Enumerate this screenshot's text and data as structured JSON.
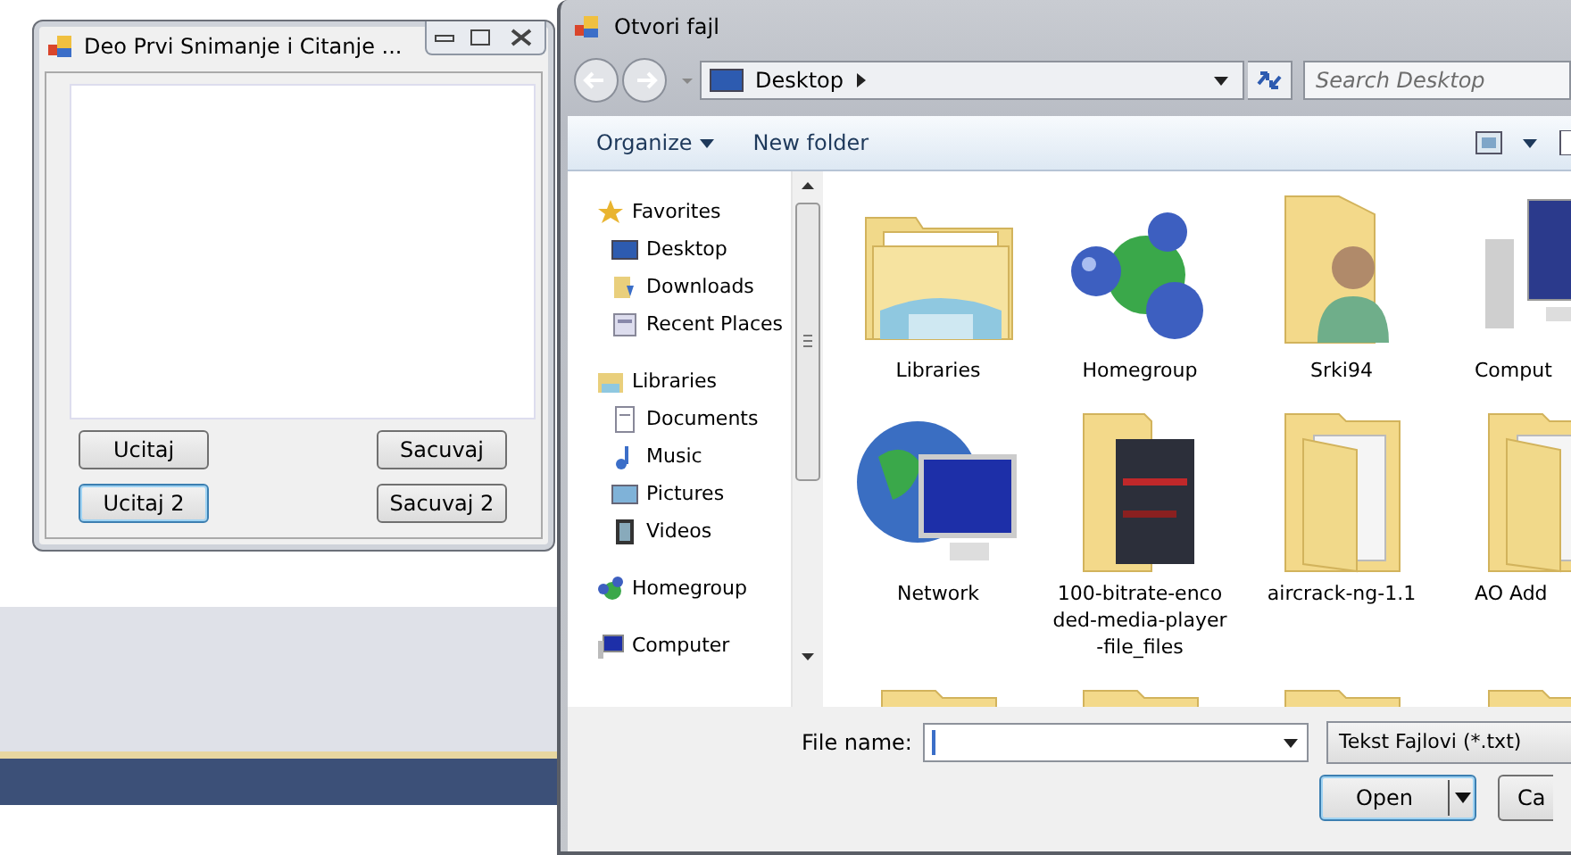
{
  "app_window": {
    "title": "Deo Prvi Snimanje i Citanje ...",
    "buttons": [
      {
        "label": "Ucitaj",
        "focused": false
      },
      {
        "label": "Sacuvaj",
        "focused": false
      },
      {
        "label": "Ucitaj 2",
        "focused": true
      },
      {
        "label": "Sacuvaj 2",
        "focused": false
      }
    ]
  },
  "dialog": {
    "title": "Otvori fajl",
    "address": "Desktop",
    "search": {
      "placeholder": "Search Desktop"
    },
    "toolbar": [
      "Organize",
      "New folder"
    ],
    "nav": [
      {
        "label": "Favorites",
        "kind": "star",
        "children": [
          {
            "label": "Desktop",
            "kind": "desktop"
          },
          {
            "label": "Downloads",
            "kind": "downloads"
          },
          {
            "label": "Recent Places",
            "kind": "recent"
          }
        ]
      },
      {
        "label": "Libraries",
        "kind": "libraries",
        "children": [
          {
            "label": "Documents",
            "kind": "document"
          },
          {
            "label": "Music",
            "kind": "music"
          },
          {
            "label": "Pictures",
            "kind": "pictures"
          },
          {
            "label": "Videos",
            "kind": "videos"
          }
        ]
      },
      {
        "label": "Homegroup",
        "kind": "homegroup"
      },
      {
        "label": "Computer",
        "kind": "computer"
      }
    ],
    "items": [
      {
        "label": "Libraries",
        "kind": "libraries"
      },
      {
        "label": "Homegroup",
        "kind": "homegroup"
      },
      {
        "label": "Srki94",
        "kind": "user"
      },
      {
        "label": "Comput",
        "kind": "computer"
      },
      {
        "label": "Network",
        "kind": "network"
      },
      {
        "label": "100-bitrate-encoded-media-player-file_files",
        "kind": "media"
      },
      {
        "label": "aircrack-ng-1.1",
        "kind": "folder"
      },
      {
        "label": "AO Add",
        "kind": "folder"
      },
      {
        "kind": "folder"
      },
      {
        "kind": "folder"
      },
      {
        "kind": "folder"
      },
      {
        "kind": "folder"
      }
    ],
    "file_name": {
      "label": "File name:"
    },
    "filter": "Tekst Fajlovi (*.txt)",
    "buttons": [
      {
        "label": "Open",
        "kind": "split"
      },
      {
        "label": "Ca",
        "kind": "plain"
      }
    ]
  }
}
